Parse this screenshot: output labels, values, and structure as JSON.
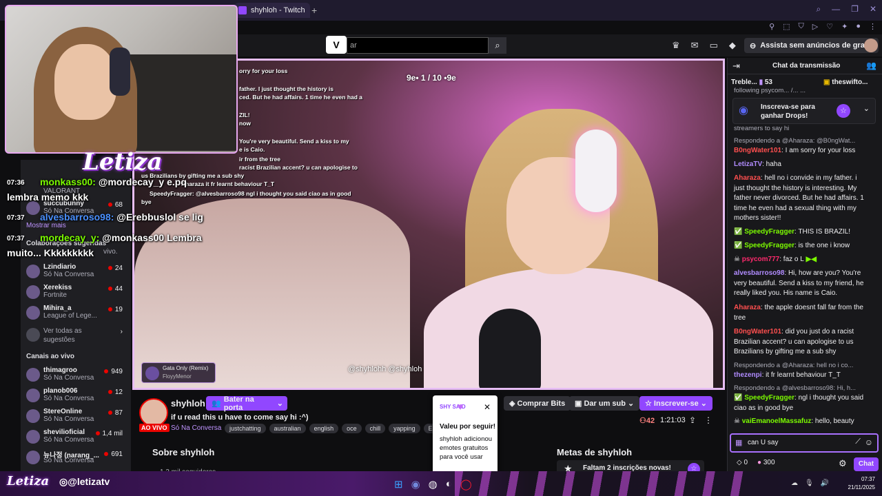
{
  "browser": {
    "tab_title": "shyhloh - Twitch",
    "new_tab_icon": "+"
  },
  "nav": {
    "logo": "V",
    "search_placeholder": "ar",
    "ad_free_label": "Assista sem anúncios de graça"
  },
  "overlay_chat": [
    {
      "time": "07:36",
      "user": "monkass00:",
      "text": "@mordecay_y e.pq",
      "line2": "lembra memo kkk"
    },
    {
      "time": "07:37",
      "user": "alvesbarroso98:",
      "text": "@Erebbuslol se lig"
    },
    {
      "time": "07:37",
      "user": "mordecay_y:",
      "text": "@monkass00 Lembra",
      "line2": "muito... Kkkkkkkkk"
    }
  ],
  "overlay_logo": "Letiza",
  "sidebar": {
    "top_channels": [
      {
        "game": "VALORANT",
        "name": "succubunny",
        "game2": "Só Na Conversa",
        "viewers": "68"
      }
    ],
    "show_more": "Mostrar mais",
    "collab_header": "Colaborações sugeridas",
    "collab_note": "vivo.",
    "suggested": [
      {
        "name": "Lzindiario",
        "game": "Só Na Conversa",
        "viewers": "24"
      },
      {
        "name": "Xerekiss",
        "game": "Fortnite",
        "viewers": "44"
      },
      {
        "name": "Mihira_a",
        "game": "League of Lege...",
        "viewers": "19"
      }
    ],
    "see_all": "Ver todas as sugestões",
    "live_header": "Canais ao vivo",
    "live": [
      {
        "name": "thimagroo",
        "game": "Só Na Conversa",
        "viewers": "949"
      },
      {
        "name": "planob006",
        "game": "Só Na Conversa",
        "viewers": "12"
      },
      {
        "name": "StereOnline",
        "game": "Só Na Conversa",
        "viewers": "87"
      },
      {
        "name": "shevilioficial",
        "game": "Só Na Conversa",
        "viewers": "1,4 mil"
      },
      {
        "name": "뉴나정 (narang_...",
        "game": "Só Na Conversa",
        "viewers": "691"
      }
    ]
  },
  "video": {
    "counter": "9e• 1 / 10 •9e",
    "handles": "@shyhlohh   @shyhloh",
    "now_playing_song": "Gata Only (Remix)",
    "now_playing_artist": "FloyyMenor",
    "embedded_chat": [
      "orry for your loss",
      "father. I just thought the history is",
      "ced. But he had affairs. 1 time he even had a",
      "ZIL!",
      "now",
      "You're very beautiful. Send a kiss to my",
      "e is Caio.",
      "ir from the tree",
      "racist Brazilian accent? u can apologise to",
      "us Brazilians by gifting me a sub shy",
      "Aharaza it fr learnt behaviour T_T",
      "SpeedyFragger: @alvesbarroso98 ngl i thought you said ciao as in good",
      "bye"
    ]
  },
  "channel": {
    "name": "shyhloh",
    "live_label": "AO VIVO",
    "raid_label": "Bater na porta",
    "title": "if u read this u have to come say hi :^)",
    "category": "Só Na Conversa",
    "tags": [
      "justchatting",
      "australian",
      "english",
      "oce",
      "chill",
      "yapping",
      "English"
    ],
    "buy_bits": "Comprar Bits",
    "gift_sub": "Dar um sub",
    "subscribe": "Inscrever-se",
    "viewers": "42",
    "uptime": "1:21:03",
    "about": "Sobre shyhloh",
    "followers": "1,3 mil seguidores",
    "goals_title": "Metas de shyhloh",
    "goal_text": "Faltam 2 inscrições novas!"
  },
  "popup": {
    "emote_label": "SHY SAID",
    "title": "Valeu por seguir!",
    "body": "shyhloh adicionou emotes gratuitos para você usar"
  },
  "chat": {
    "title": "Chat da transmissão",
    "hype_a": "Treble...",
    "hype_a_count": "53",
    "hype_b": "theswifto...",
    "drops_text": "Inscreva-se para ganhar Drops!",
    "partial_top": "following psycom... /... ...",
    "partial_top2": "streamers to say hi",
    "messages": [
      {
        "type": "reply",
        "text": "Respondendo a @Aharaza: @B0ngWat..."
      },
      {
        "user": "B0ngWater101",
        "color": "#ff4f4f",
        "text": ": I am sorry for your loss"
      },
      {
        "user": "LetizaTV",
        "color": "#b18cff",
        "text": ": haha"
      },
      {
        "user": "Aharaza",
        "color": "#ff4f4f",
        "text": ": hell no i convide in my father. i just thought the history is interesting. My father never divorced. But he had affairs. 1 time he even had a sexual thing with my mothers sister!!"
      },
      {
        "user": "SpeedyFragger",
        "color": "#7cfc00",
        "text": ": THIS IS BRAZIL!"
      },
      {
        "user": "SpeedyFragger",
        "color": "#7cfc00",
        "text": ": is the one i know"
      },
      {
        "user": "psycom777",
        "color": "#ff2a6d",
        "text": ": faz o L"
      },
      {
        "user": "alvesbarroso98",
        "color": "#b18cff",
        "text": ": Hi, how are you? You're very beautiful. Send a kiss to my friend, he really liked you. His name is Caio."
      },
      {
        "user": "Aharaza",
        "color": "#ff4f4f",
        "text": ": the apple doesnt fall far from the tree"
      },
      {
        "user": "B0ngWater101",
        "color": "#ff4f4f",
        "text": ": did you just do a racist Brazilian accent? u can apologise to us Brazilians by gifting me a sub shy"
      },
      {
        "type": "reply",
        "text": "Respondendo a @Aharaza: hell no i co..."
      },
      {
        "user": "thezenpi",
        "color": "#b18cff",
        "text": ": it fr learnt behaviour T_T"
      },
      {
        "type": "reply",
        "text": "Respondendo a @alvesbarroso98: Hi, h..."
      },
      {
        "user": "SpeedyFragger",
        "color": "#7cfc00",
        "text": ": ngl i thought you said ciao as in good bye"
      },
      {
        "user": "vaiEmanoelMassafuz",
        "color": "#7cfc00",
        "text": ": hello, beauty"
      }
    ],
    "input_value": "can U say",
    "points": "0",
    "bits": "300",
    "chat_button": "Chat"
  },
  "bottom": {
    "logo": "Letiza",
    "handle": "@letizatv",
    "time": "07:37",
    "date": "21/11/2025"
  },
  "colors": {
    "twitch_purple": "#9147ff",
    "live_red": "#eb0400",
    "bg": "#0e0e10"
  }
}
